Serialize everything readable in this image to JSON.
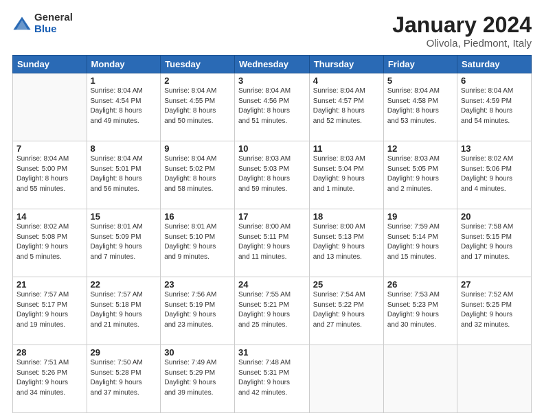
{
  "logo": {
    "general": "General",
    "blue": "Blue"
  },
  "header": {
    "month_year": "January 2024",
    "location": "Olivola, Piedmont, Italy"
  },
  "weekdays": [
    "Sunday",
    "Monday",
    "Tuesday",
    "Wednesday",
    "Thursday",
    "Friday",
    "Saturday"
  ],
  "weeks": [
    [
      {
        "day": "",
        "info": ""
      },
      {
        "day": "1",
        "info": "Sunrise: 8:04 AM\nSunset: 4:54 PM\nDaylight: 8 hours\nand 49 minutes."
      },
      {
        "day": "2",
        "info": "Sunrise: 8:04 AM\nSunset: 4:55 PM\nDaylight: 8 hours\nand 50 minutes."
      },
      {
        "day": "3",
        "info": "Sunrise: 8:04 AM\nSunset: 4:56 PM\nDaylight: 8 hours\nand 51 minutes."
      },
      {
        "day": "4",
        "info": "Sunrise: 8:04 AM\nSunset: 4:57 PM\nDaylight: 8 hours\nand 52 minutes."
      },
      {
        "day": "5",
        "info": "Sunrise: 8:04 AM\nSunset: 4:58 PM\nDaylight: 8 hours\nand 53 minutes."
      },
      {
        "day": "6",
        "info": "Sunrise: 8:04 AM\nSunset: 4:59 PM\nDaylight: 8 hours\nand 54 minutes."
      }
    ],
    [
      {
        "day": "7",
        "info": "Sunrise: 8:04 AM\nSunset: 5:00 PM\nDaylight: 8 hours\nand 55 minutes."
      },
      {
        "day": "8",
        "info": "Sunrise: 8:04 AM\nSunset: 5:01 PM\nDaylight: 8 hours\nand 56 minutes."
      },
      {
        "day": "9",
        "info": "Sunrise: 8:04 AM\nSunset: 5:02 PM\nDaylight: 8 hours\nand 58 minutes."
      },
      {
        "day": "10",
        "info": "Sunrise: 8:03 AM\nSunset: 5:03 PM\nDaylight: 8 hours\nand 59 minutes."
      },
      {
        "day": "11",
        "info": "Sunrise: 8:03 AM\nSunset: 5:04 PM\nDaylight: 9 hours\nand 1 minute."
      },
      {
        "day": "12",
        "info": "Sunrise: 8:03 AM\nSunset: 5:05 PM\nDaylight: 9 hours\nand 2 minutes."
      },
      {
        "day": "13",
        "info": "Sunrise: 8:02 AM\nSunset: 5:06 PM\nDaylight: 9 hours\nand 4 minutes."
      }
    ],
    [
      {
        "day": "14",
        "info": "Sunrise: 8:02 AM\nSunset: 5:08 PM\nDaylight: 9 hours\nand 5 minutes."
      },
      {
        "day": "15",
        "info": "Sunrise: 8:01 AM\nSunset: 5:09 PM\nDaylight: 9 hours\nand 7 minutes."
      },
      {
        "day": "16",
        "info": "Sunrise: 8:01 AM\nSunset: 5:10 PM\nDaylight: 9 hours\nand 9 minutes."
      },
      {
        "day": "17",
        "info": "Sunrise: 8:00 AM\nSunset: 5:11 PM\nDaylight: 9 hours\nand 11 minutes."
      },
      {
        "day": "18",
        "info": "Sunrise: 8:00 AM\nSunset: 5:13 PM\nDaylight: 9 hours\nand 13 minutes."
      },
      {
        "day": "19",
        "info": "Sunrise: 7:59 AM\nSunset: 5:14 PM\nDaylight: 9 hours\nand 15 minutes."
      },
      {
        "day": "20",
        "info": "Sunrise: 7:58 AM\nSunset: 5:15 PM\nDaylight: 9 hours\nand 17 minutes."
      }
    ],
    [
      {
        "day": "21",
        "info": "Sunrise: 7:57 AM\nSunset: 5:17 PM\nDaylight: 9 hours\nand 19 minutes."
      },
      {
        "day": "22",
        "info": "Sunrise: 7:57 AM\nSunset: 5:18 PM\nDaylight: 9 hours\nand 21 minutes."
      },
      {
        "day": "23",
        "info": "Sunrise: 7:56 AM\nSunset: 5:19 PM\nDaylight: 9 hours\nand 23 minutes."
      },
      {
        "day": "24",
        "info": "Sunrise: 7:55 AM\nSunset: 5:21 PM\nDaylight: 9 hours\nand 25 minutes."
      },
      {
        "day": "25",
        "info": "Sunrise: 7:54 AM\nSunset: 5:22 PM\nDaylight: 9 hours\nand 27 minutes."
      },
      {
        "day": "26",
        "info": "Sunrise: 7:53 AM\nSunset: 5:23 PM\nDaylight: 9 hours\nand 30 minutes."
      },
      {
        "day": "27",
        "info": "Sunrise: 7:52 AM\nSunset: 5:25 PM\nDaylight: 9 hours\nand 32 minutes."
      }
    ],
    [
      {
        "day": "28",
        "info": "Sunrise: 7:51 AM\nSunset: 5:26 PM\nDaylight: 9 hours\nand 34 minutes."
      },
      {
        "day": "29",
        "info": "Sunrise: 7:50 AM\nSunset: 5:28 PM\nDaylight: 9 hours\nand 37 minutes."
      },
      {
        "day": "30",
        "info": "Sunrise: 7:49 AM\nSunset: 5:29 PM\nDaylight: 9 hours\nand 39 minutes."
      },
      {
        "day": "31",
        "info": "Sunrise: 7:48 AM\nSunset: 5:31 PM\nDaylight: 9 hours\nand 42 minutes."
      },
      {
        "day": "",
        "info": ""
      },
      {
        "day": "",
        "info": ""
      },
      {
        "day": "",
        "info": ""
      }
    ]
  ]
}
